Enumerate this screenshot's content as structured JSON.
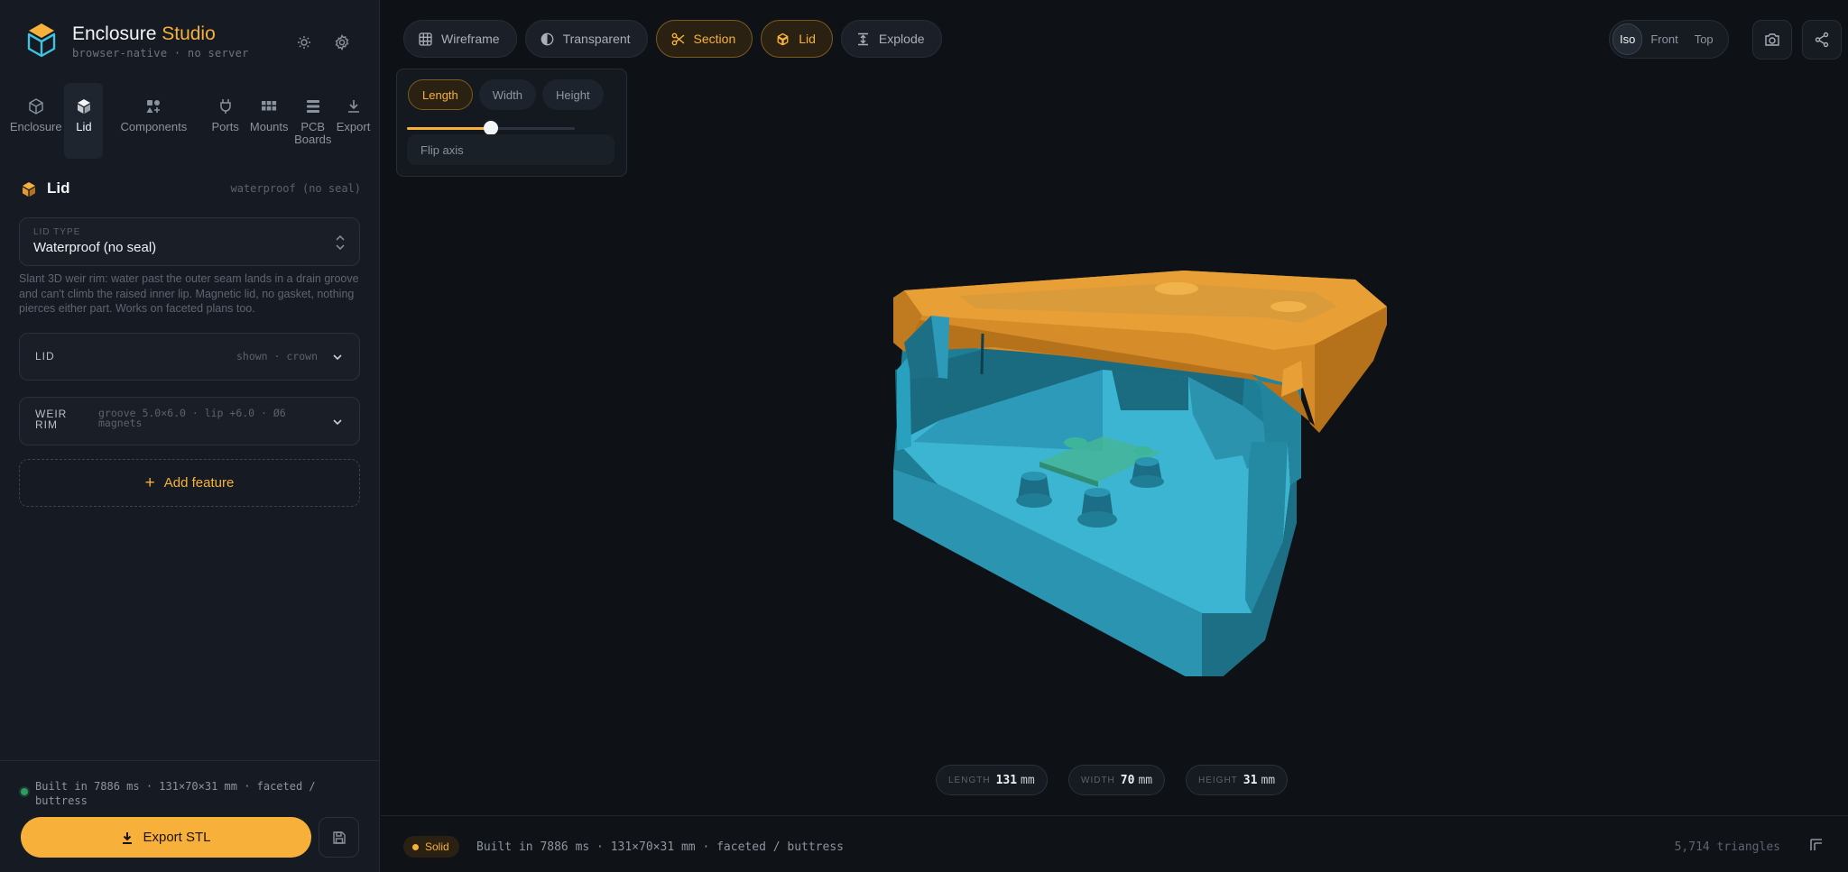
{
  "app": {
    "title_main": "Enclosure",
    "title_accent": "Studio",
    "subtitle": "browser-native · no server"
  },
  "tabs": [
    {
      "label": "Enclosure",
      "icon": "cube-outline-icon",
      "active": false
    },
    {
      "label": "Lid",
      "icon": "cube-solid-icon",
      "active": true
    },
    {
      "label": "Components",
      "icon": "shapes-icon",
      "active": false
    },
    {
      "label": "Ports",
      "icon": "plug-icon",
      "active": false
    },
    {
      "label": "Mounts",
      "icon": "grid-icon",
      "active": false
    },
    {
      "label": "PCB Boards",
      "icon": "stack-icon",
      "active": false
    },
    {
      "label": "Export",
      "icon": "download-icon",
      "active": false
    }
  ],
  "panel": {
    "title": "Lid",
    "tag": "waterproof (no seal)",
    "lid_type_caption": "LID TYPE",
    "lid_type_value": "Waterproof (no seal)",
    "description": "Slant 3D weir rim: water past the outer seam lands in a drain groove and can't climb the raised inner lip. Magnetic lid, no gasket, nothing pierces either part. Works on faceted plans too.",
    "sections": [
      {
        "name": "LID",
        "meta": "shown · crown"
      },
      {
        "name": "WEIR RIM",
        "meta": "groove 5.0×6.0 · lip +6.0 · Ø6 magnets"
      }
    ],
    "add_feature": "Add feature"
  },
  "sidebar_footer": {
    "status": "Built in 7886 ms · 131×70×31 mm · faceted / buttress",
    "export_label": "Export STL"
  },
  "toolbar": [
    {
      "label": "Wireframe",
      "icon": "grid-icon",
      "active": false
    },
    {
      "label": "Transparent",
      "icon": "half-circle-icon",
      "active": false
    },
    {
      "label": "Section",
      "icon": "scissors-icon",
      "active": true
    },
    {
      "label": "Lid",
      "icon": "cube-solid-icon",
      "active": true
    },
    {
      "label": "Explode",
      "icon": "explode-icon",
      "active": false
    }
  ],
  "section": {
    "axes": [
      {
        "label": "Length",
        "active": true
      },
      {
        "label": "Width",
        "active": false
      },
      {
        "label": "Height",
        "active": false
      }
    ],
    "slider_value": 0.5,
    "flip_label": "Flip axis"
  },
  "views": [
    {
      "label": "Iso",
      "active": true
    },
    {
      "label": "Front",
      "active": false
    },
    {
      "label": "Top",
      "active": false
    }
  ],
  "dimensions": [
    {
      "key": "LENGTH",
      "value": "131",
      "unit": "mm"
    },
    {
      "key": "WIDTH",
      "value": "70",
      "unit": "mm"
    },
    {
      "key": "HEIGHT",
      "value": "31",
      "unit": "mm"
    }
  ],
  "statusbar": {
    "mode": "Solid",
    "text": "Built in 7886 ms · 131×70×31 mm · faceted / buttress",
    "triangles": "5,714 triangles"
  },
  "colors": {
    "accent": "#f7b13a",
    "lid": "#e49a2e",
    "body": "#2fa6c4",
    "pcb": "#3fae8e",
    "status_ok": "#2e9b5f"
  }
}
